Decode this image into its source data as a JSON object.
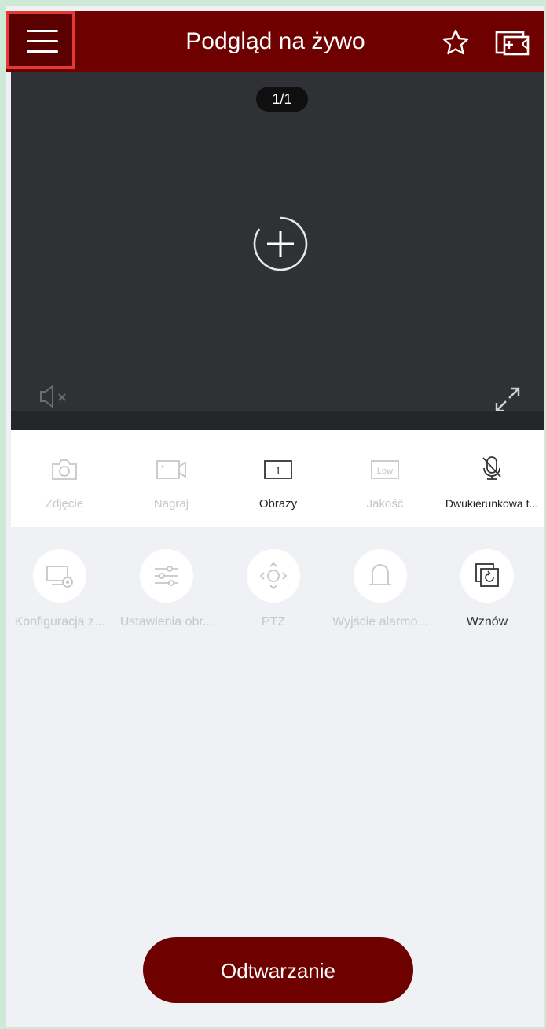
{
  "header": {
    "title": "Podgląd na żywo",
    "menu_icon": "hamburger-menu-icon",
    "favorite_icon": "star-icon",
    "multiscreen_icon": "add-window-icon"
  },
  "video": {
    "page_indicator": "1/1",
    "add_icon": "add-device-icon",
    "mute_icon": "speaker-muted-icon",
    "fullscreen_icon": "expand-icon"
  },
  "toolbar": {
    "items": [
      {
        "label": "Zdjęcie",
        "icon": "camera-icon",
        "enabled": false
      },
      {
        "label": "Nagraj",
        "icon": "video-record-icon",
        "enabled": false
      },
      {
        "label": "Obrazy",
        "icon": "screen-split-1-icon",
        "enabled": true,
        "icon_text": "1"
      },
      {
        "label": "Jakość",
        "icon": "quality-low-icon",
        "enabled": false,
        "icon_text": "Low"
      },
      {
        "label": "Dwukierunkowa t...",
        "icon": "microphone-off-icon",
        "enabled": true
      }
    ]
  },
  "functions": {
    "items": [
      {
        "label": "Konfiguracja z...",
        "icon": "device-config-icon",
        "enabled": false
      },
      {
        "label": "Ustawienia obr...",
        "icon": "sliders-icon",
        "enabled": false
      },
      {
        "label": "PTZ",
        "icon": "ptz-joystick-icon",
        "enabled": false
      },
      {
        "label": "Wyjście alarmo...",
        "icon": "alarm-bell-icon",
        "enabled": false
      },
      {
        "label": "Wznów",
        "icon": "restore-icon",
        "enabled": true
      }
    ]
  },
  "playback_button": "Odtwarzanie",
  "colors": {
    "brand": "#6e0000",
    "video_bg": "#2f3135",
    "disabled_text": "#c6c6cb",
    "page_bg": "#f0f1f5"
  }
}
